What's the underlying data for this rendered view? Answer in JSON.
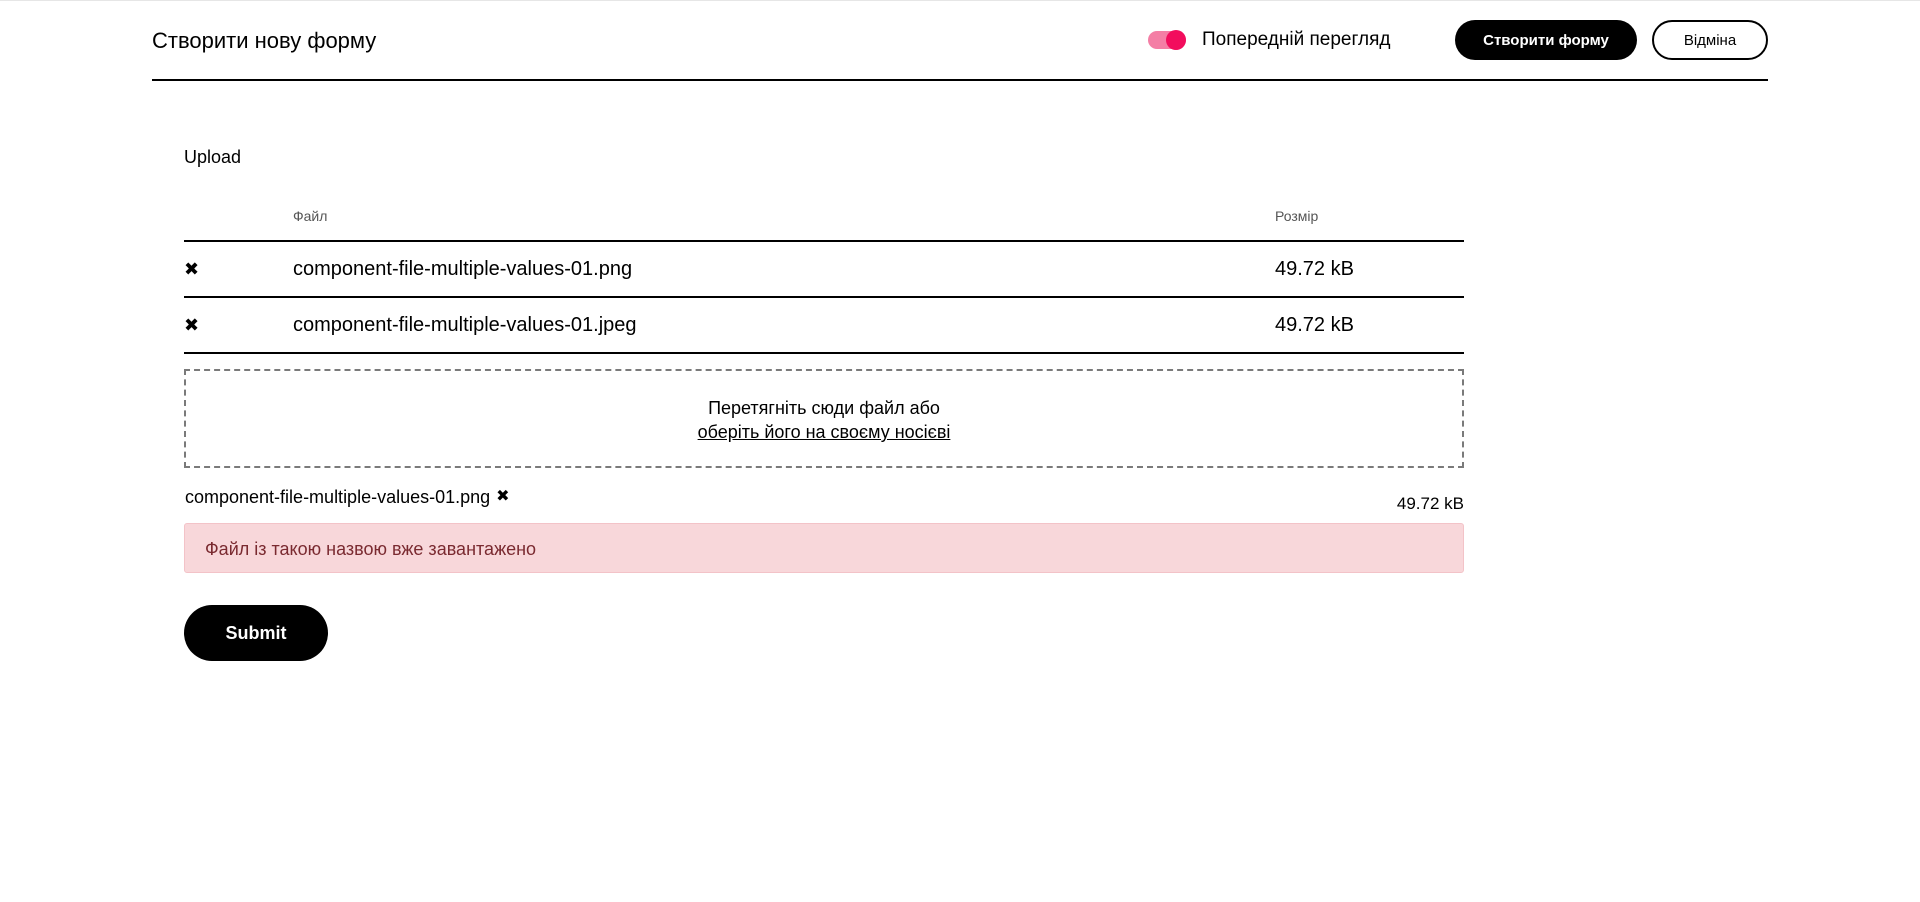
{
  "header": {
    "title": "Створити нову форму",
    "preview_label": "Попередній перегляд",
    "preview_enabled": true,
    "create_button": "Створити форму",
    "cancel_button": "Відміна"
  },
  "upload": {
    "label": "Upload",
    "columns": {
      "file": "Файл",
      "size": "Розмір"
    },
    "files": [
      {
        "name": "component-file-multiple-values-01.png",
        "size": "49.72 kB",
        "remove_icon": "close-icon"
      },
      {
        "name": "component-file-multiple-values-01.jpeg",
        "size": "49.72 kB",
        "remove_icon": "close-icon"
      }
    ],
    "dropzone": {
      "text": "Перетягніть сюди файл або",
      "link": "оберіть його на своєму носієві"
    },
    "pending": {
      "name": "component-file-multiple-values-01.png",
      "size": "49.72 kB"
    },
    "error": "Файл із такою назвою вже завантажено"
  },
  "form": {
    "submit_label": "Submit"
  },
  "colors": {
    "toggle_track": "#f47ea5",
    "toggle_knob": "#f20d5d",
    "error_bg": "#f8d7da",
    "error_text": "#7a2a30"
  }
}
